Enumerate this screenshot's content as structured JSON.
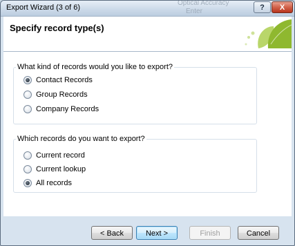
{
  "window": {
    "title": "Export Wizard (3 of 6)",
    "help_label": "?",
    "close_label": "X",
    "background_ghost_text_1": "Optical Accuracy",
    "background_ghost_text_2": "Enter"
  },
  "header": {
    "title": "Specify record type(s)"
  },
  "record_kind_group": {
    "label": "What kind of records would you like to export?",
    "options": [
      {
        "label": "Contact Records",
        "checked": true
      },
      {
        "label": "Group Records",
        "checked": false
      },
      {
        "label": "Company Records",
        "checked": false
      }
    ]
  },
  "which_records_group": {
    "label": "Which records do you want to export?",
    "options": [
      {
        "label": "Current record",
        "checked": false
      },
      {
        "label": "Current lookup",
        "checked": false
      },
      {
        "label": "All records",
        "checked": true
      }
    ]
  },
  "buttons": {
    "back": "< Back",
    "next": "Next >",
    "finish": "Finish",
    "cancel": "Cancel"
  },
  "colors": {
    "leaf_dark": "#8fb82f",
    "leaf_light": "#b9d66a",
    "accent": "#3c7fb1"
  }
}
